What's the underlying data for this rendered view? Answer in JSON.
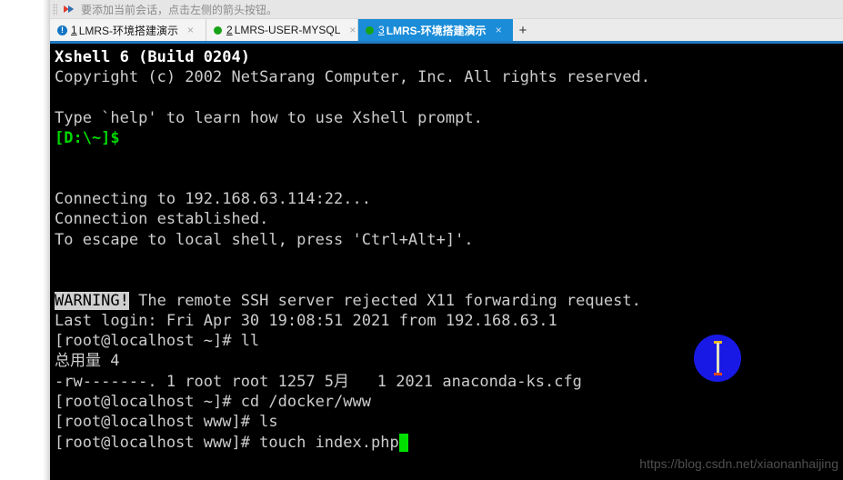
{
  "window": {
    "title": "Xshell 6"
  },
  "toolbar_hint": {
    "icon": "red-arrow-icon",
    "text": "要添加当前会话，点击左侧的箭头按钮。"
  },
  "tabs": {
    "add_label": "+",
    "close_label": "×",
    "items": [
      {
        "index": "1",
        "label": "LMRS-环境搭建演示",
        "icon": "alert-badge-icon",
        "icon_char": "!",
        "active": false
      },
      {
        "index": "2",
        "label": "LMRS-USER-MYSQL",
        "icon": "green-dot-icon",
        "icon_char": "",
        "active": false
      },
      {
        "index": "3",
        "label": "LMRS-环境搭建演示",
        "icon": "green-dot-icon",
        "icon_char": "",
        "active": true
      }
    ]
  },
  "terminal": {
    "lines": [
      {
        "id": "l01",
        "text": "Xshell 6 (Build 0204)",
        "style": "white-bold"
      },
      {
        "id": "l02",
        "text": "Copyright (c) 2002 NetSarang Computer, Inc. All rights reserved.",
        "style": "normal"
      },
      {
        "id": "l03",
        "text": "",
        "style": "blank"
      },
      {
        "id": "l04",
        "text": "Type `help' to learn how to use Xshell prompt.",
        "style": "normal"
      },
      {
        "id": "l05",
        "text": "[D:\\~]$",
        "style": "green"
      },
      {
        "id": "l06",
        "text": "",
        "style": "blank"
      },
      {
        "id": "l07",
        "text": "",
        "style": "blank"
      },
      {
        "id": "l08",
        "text": "Connecting to 192.168.63.114:22...",
        "style": "normal"
      },
      {
        "id": "l09",
        "text": "Connection established.",
        "style": "normal"
      },
      {
        "id": "l10",
        "text": "To escape to local shell, press 'Ctrl+Alt+]'.",
        "style": "normal"
      },
      {
        "id": "l11",
        "text": "",
        "style": "blank"
      },
      {
        "id": "l12",
        "text": "",
        "style": "blank"
      },
      {
        "id": "l13",
        "text": "",
        "style": "inverse-lead",
        "inverse": "WARNING!",
        "rest": " The remote SSH server rejected X11 forwarding request."
      },
      {
        "id": "l14",
        "text": "Last login: Fri Apr 30 19:08:51 2021 from 192.168.63.1",
        "style": "normal"
      },
      {
        "id": "l15",
        "text": "[root@localhost ~]# ll",
        "style": "normal"
      },
      {
        "id": "l16",
        "text": "总用量 4",
        "style": "normal"
      },
      {
        "id": "l17",
        "text": "-rw-------. 1 root root 1257 5月   1 2021 anaconda-ks.cfg",
        "style": "normal"
      },
      {
        "id": "l18",
        "text": "[root@localhost ~]# cd /docker/www",
        "style": "normal"
      },
      {
        "id": "l19",
        "text": "[root@localhost www]# ls",
        "style": "normal"
      },
      {
        "id": "l20",
        "text": "",
        "style": "cursor-trail",
        "rest": "[root@localhost www]# touch index.php",
        "cursor": " "
      }
    ]
  },
  "cursor_overlay": {
    "name": "click-highlight",
    "color": "#1919e6",
    "shape": "circle"
  },
  "watermark": {
    "text": "https://blog.csdn.net/xiaonanhaijing"
  }
}
